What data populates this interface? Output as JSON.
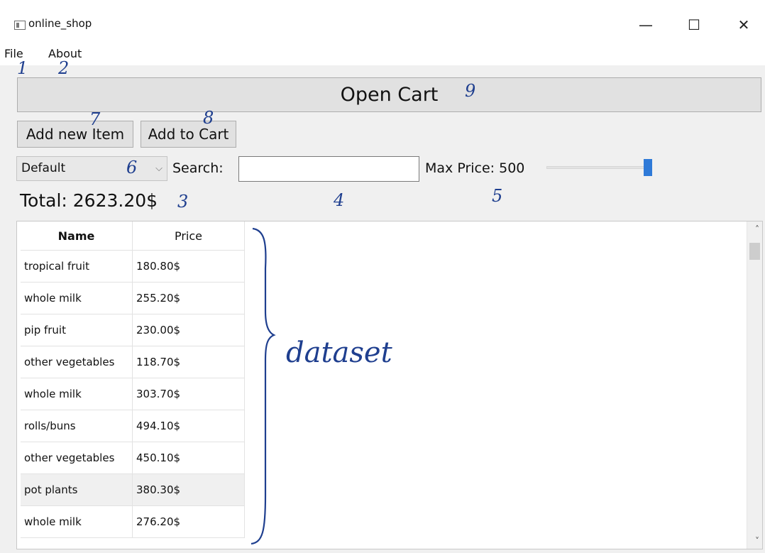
{
  "window": {
    "title": "online_shop"
  },
  "menu": {
    "items": [
      "File",
      "About"
    ]
  },
  "toolbar": {
    "open_cart": "Open Cart",
    "add_new_item": "Add new Item",
    "add_to_cart": "Add to Cart"
  },
  "filters": {
    "sort_selected": "Default",
    "search_label": "Search:",
    "search_value": "",
    "max_price_label": "Max Price: 500",
    "max_price_fraction": 1.0
  },
  "summary": {
    "total": "Total: 2623.20$"
  },
  "table": {
    "headers": [
      "Name",
      "Price"
    ],
    "rows": [
      [
        "tropical fruit",
        "180.80$"
      ],
      [
        "whole milk",
        "255.20$"
      ],
      [
        "pip fruit",
        "230.00$"
      ],
      [
        "other vegetables",
        "118.70$"
      ],
      [
        "whole milk",
        "303.70$"
      ],
      [
        "rolls/buns",
        "494.10$"
      ],
      [
        "other vegetables",
        "450.10$"
      ],
      [
        "pot plants",
        "380.30$"
      ],
      [
        "whole milk",
        "276.20$"
      ]
    ]
  },
  "annotations": [
    "1",
    "2",
    "3",
    "4",
    "5",
    "6",
    "7",
    "8",
    "9",
    "dataset"
  ],
  "colors": {
    "accent": "#2f7ad8",
    "annotation": "#1f3f8f"
  },
  "icons": {
    "app": "window-icon",
    "minimize": "minimize-icon",
    "maximize": "maximize-icon",
    "close": "close-icon",
    "dropdown": "chevron-down-icon",
    "scroll_up": "chevron-up-icon",
    "scroll_down": "chevron-down-icon"
  }
}
